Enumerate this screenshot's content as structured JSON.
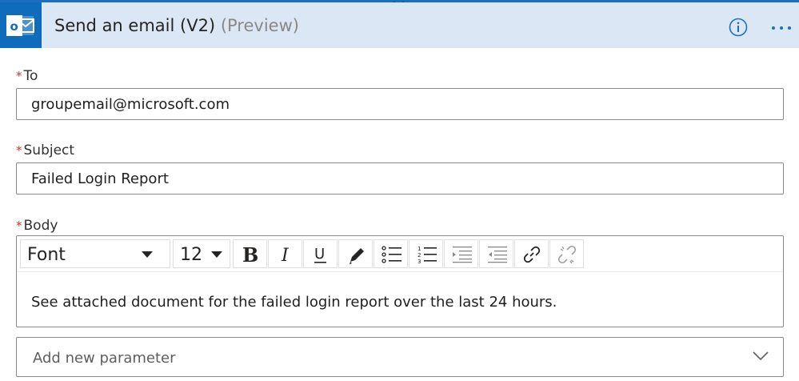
{
  "header": {
    "title": "Send an email (V2)",
    "subtitle": "(Preview)",
    "logo_icon": "outlook-icon",
    "info_icon": "info-icon",
    "more_icon": "more-options-icon"
  },
  "fields": {
    "to": {
      "required_mark": "*",
      "label": "To",
      "value": "groupemail@microsoft.com"
    },
    "subject": {
      "required_mark": "*",
      "label": "Subject",
      "value": "Failed Login Report"
    },
    "body": {
      "required_mark": "*",
      "label": "Body",
      "font": "Font",
      "font_size": "12",
      "text": "See attached document for the failed login report over the last 24 hours."
    }
  },
  "toolbar": {
    "buttons": [
      "bold-icon",
      "italic-icon",
      "underline-icon",
      "text-color-icon",
      "bullet-list-icon",
      "numbered-list-icon",
      "increase-indent-icon",
      "decrease-indent-icon",
      "link-icon",
      "unlink-icon"
    ]
  },
  "add_parameter": {
    "placeholder": "Add new parameter"
  },
  "colors": {
    "header_bg": "#dbe7f4",
    "accent": "#0f6cbd",
    "required": "#d13438"
  }
}
